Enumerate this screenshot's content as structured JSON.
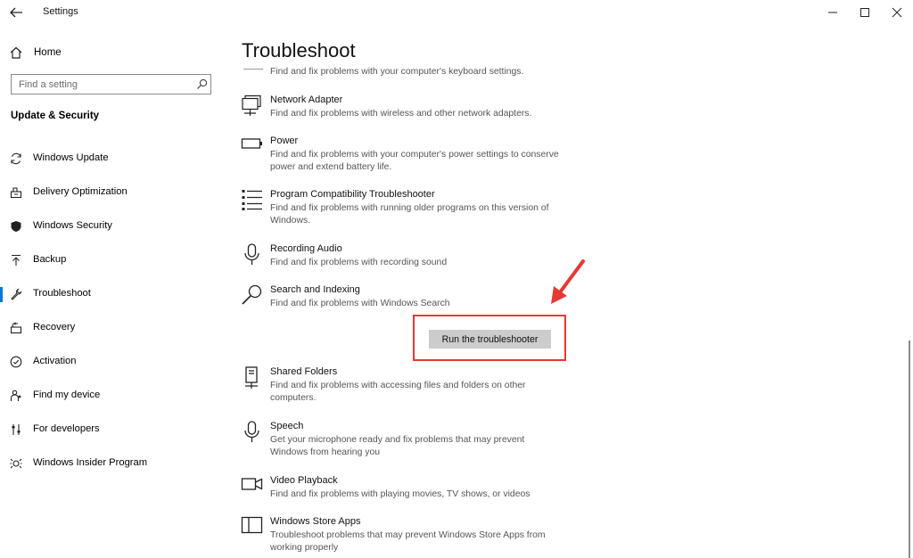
{
  "window": {
    "title": "Settings"
  },
  "sidebar": {
    "home_label": "Home",
    "search_placeholder": "Find a setting",
    "section_title": "Update & Security",
    "items": [
      {
        "label": "Windows Update",
        "icon": "sync-icon",
        "selected": false
      },
      {
        "label": "Delivery Optimization",
        "icon": "delivery-optimization-icon",
        "selected": false
      },
      {
        "label": "Windows Security",
        "icon": "shield-icon",
        "selected": false
      },
      {
        "label": "Backup",
        "icon": "backup-upload-icon",
        "selected": false
      },
      {
        "label": "Troubleshoot",
        "icon": "wrench-icon",
        "selected": true
      },
      {
        "label": "Recovery",
        "icon": "recovery-icon",
        "selected": false
      },
      {
        "label": "Activation",
        "icon": "activation-check-icon",
        "selected": false
      },
      {
        "label": "Find my device",
        "icon": "person-location-icon",
        "selected": false
      },
      {
        "label": "For developers",
        "icon": "developer-sliders-icon",
        "selected": false
      },
      {
        "label": "Windows Insider Program",
        "icon": "insider-icon",
        "selected": false
      }
    ]
  },
  "main": {
    "title": "Troubleshoot",
    "keyboard_desc": "Find and fix problems with your computer's keyboard settings.",
    "items": [
      {
        "name": "Network Adapter",
        "desc": "Find and fix problems with wireless and other network adapters.",
        "icon": "network-adapter-icon"
      },
      {
        "name": "Power",
        "desc": "Find and fix problems with your computer's power settings to conserve power and extend battery life.",
        "icon": "battery-icon"
      },
      {
        "name": "Program Compatibility Troubleshooter",
        "desc": "Find and fix problems with running older programs on this version of Windows.",
        "icon": "list-icon"
      },
      {
        "name": "Recording Audio",
        "desc": "Find and fix problems with recording sound",
        "icon": "microphone-icon"
      },
      {
        "name": "Search and Indexing",
        "desc": "Find and fix problems with Windows Search",
        "icon": "search-icon"
      },
      {
        "name": "Shared Folders",
        "desc": "Find and fix problems with accessing files and folders on other computers.",
        "icon": "shared-folders-icon"
      },
      {
        "name": "Speech",
        "desc": "Get your microphone ready and fix problems that may prevent Windows from hearing you",
        "icon": "microphone-icon"
      },
      {
        "name": "Video Playback",
        "desc": "Find and fix problems with playing movies, TV shows, or videos",
        "icon": "video-camera-icon"
      },
      {
        "name": "Windows Store Apps",
        "desc": "Troubleshoot problems that may prevent Windows Store Apps from working properly",
        "icon": "store-apps-icon"
      }
    ],
    "run_button_label": "Run the troubleshooter"
  },
  "colors": {
    "accent": "#0078d7",
    "highlight_red": "#e53935",
    "button_gray": "#cccccc"
  }
}
